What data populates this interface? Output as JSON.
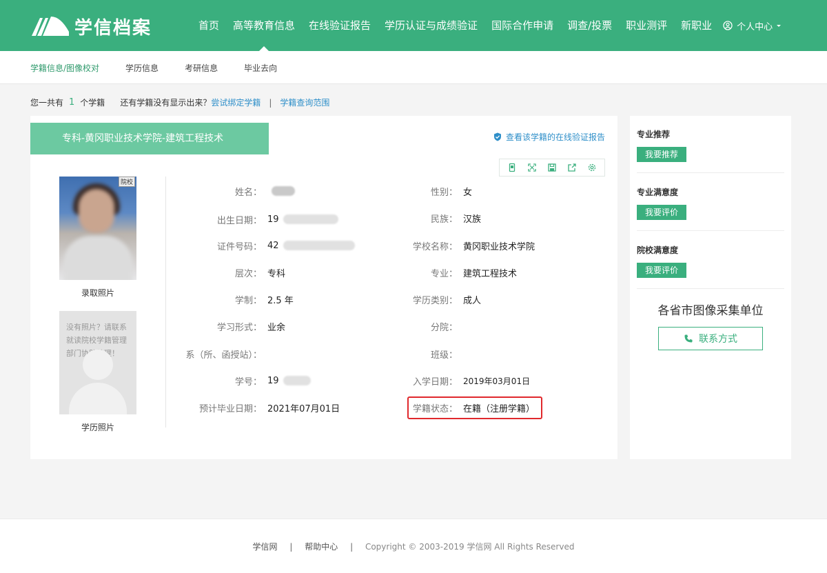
{
  "header": {
    "logo_text": "学信档案",
    "nav": [
      "首页",
      "高等教育信息",
      "在线验证报告",
      "学历认证与成绩验证",
      "国际合作申请",
      "调查/投票",
      "职业测评",
      "新职业"
    ],
    "user_center": "个人中心"
  },
  "subnav": [
    "学籍信息/图像校对",
    "学历信息",
    "考研信息",
    "毕业去向"
  ],
  "summary": {
    "prefix": "您一共有",
    "count": "1",
    "suffix": "个学籍",
    "hint": "还有学籍没有显示出来？",
    "bind_link": "尝试绑定学籍",
    "scope_link": "学籍查询范围",
    "separator": "|"
  },
  "card": {
    "tab_title": "专科-黄冈职业技术学院-建筑工程技术",
    "verify_link": "查看该学籍的在线验证报告",
    "photo_tag": "院校",
    "admission_photo_caption": "录取照片",
    "no_photo_message": "没有照片？请联系就读院校学籍管理部门协助处理！",
    "degree_photo_caption": "学历照片",
    "fields": {
      "name_label": "姓名：",
      "gender_label": "性别：",
      "gender_value": "女",
      "birth_label": "出生日期：",
      "birth_prefix": "19",
      "ethnicity_label": "民族：",
      "ethnicity_value": "汉族",
      "id_label": "证件号码：",
      "id_prefix": "42",
      "school_label": "学校名称：",
      "school_value": "黄冈职业技术学院",
      "level_label": "层次：",
      "level_value": "专科",
      "major_label": "专业：",
      "major_value": "建筑工程技术",
      "duration_label": "学制：",
      "duration_value": "2.5 年",
      "category_label": "学历类别：",
      "category_value": "成人",
      "mode_label": "学习形式：",
      "mode_value": "业余",
      "branch_label": "分院：",
      "dept_label": "系（所、函授站）：",
      "class_label": "班级：",
      "student_no_label": "学号：",
      "student_no_prefix": "19",
      "enroll_label": "入学日期：",
      "enroll_value": "2019年03月01日",
      "grad_label": "预计毕业日期：",
      "grad_value": "2021年07月01日",
      "status_label": "学籍状态：",
      "status_value": "在籍（注册学籍）"
    }
  },
  "side": {
    "major_rec_title": "专业推荐",
    "major_rec_btn": "我要推荐",
    "major_sat_title": "专业满意度",
    "major_sat_btn": "我要评价",
    "school_sat_title": "院校满意度",
    "school_sat_btn": "我要评价",
    "collect_heading": "各省市图像采集单位",
    "contact_btn": "联系方式"
  },
  "footer": {
    "site": "学信网",
    "help": "帮助中心",
    "copyright": "Copyright © 2003-2019 学信网 All Rights Reserved",
    "separator": "|"
  },
  "colors": {
    "brand": "#3aaf7e",
    "tab": "#6cc9a1",
    "link": "#2f8fc9",
    "highlight": "#e0282c"
  },
  "icons": [
    "logo-mark-icon",
    "user-circle-icon",
    "caret-down-icon",
    "shield-check-icon",
    "mobile-icon",
    "fullscreen-icon",
    "save-icon",
    "share-icon",
    "gear-icon",
    "phone-icon"
  ]
}
